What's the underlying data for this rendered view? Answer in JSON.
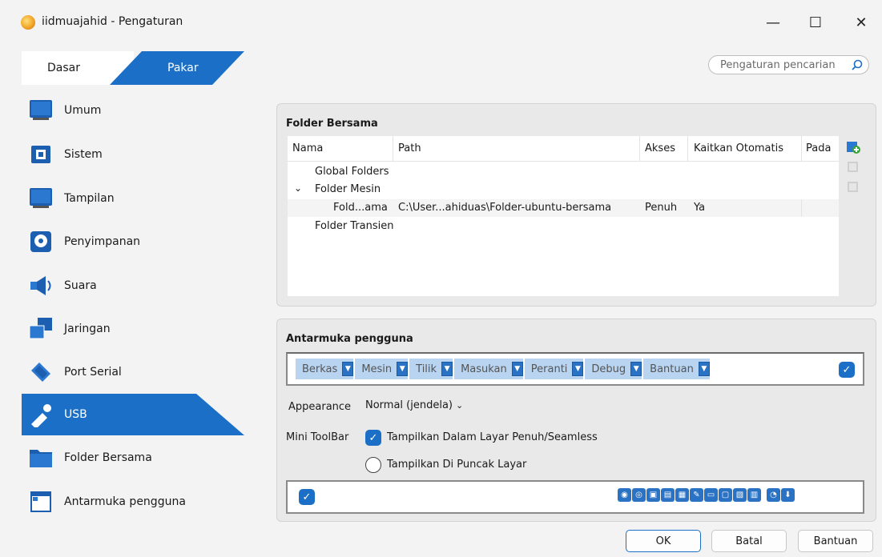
{
  "window": {
    "title": "iidmuajahid - Pengaturan",
    "minimize": "—",
    "maximize": "☐",
    "close": "✕"
  },
  "mode_tabs": {
    "basic": "Dasar",
    "expert": "Pakar"
  },
  "search": {
    "placeholder": "Pengaturan pencarian"
  },
  "sidebar": {
    "items": [
      {
        "label": "Umum",
        "icon": "monitor-icon",
        "selected": false
      },
      {
        "label": "Sistem",
        "icon": "chip-icon",
        "selected": false
      },
      {
        "label": "Tampilan",
        "icon": "display-icon",
        "selected": false
      },
      {
        "label": "Penyimpanan",
        "icon": "storage-icon",
        "selected": false
      },
      {
        "label": "Suara",
        "icon": "speaker-icon",
        "selected": false
      },
      {
        "label": "Jaringan",
        "icon": "network-icon",
        "selected": false
      },
      {
        "label": "Port Serial",
        "icon": "serial-port-icon",
        "selected": false
      },
      {
        "label": "USB",
        "icon": "usb-icon",
        "selected": true
      },
      {
        "label": "Folder Bersama",
        "icon": "folder-icon",
        "selected": false
      },
      {
        "label": "Antarmuka pengguna",
        "icon": "window-icon",
        "selected": false
      }
    ]
  },
  "shared_folders": {
    "title": "Folder Bersama",
    "columns": [
      "Nama",
      "Path",
      "Akses",
      "Kaitkan Otomatis",
      "Pada"
    ],
    "rows": [
      {
        "name": "Global Folders",
        "path": "",
        "access": "",
        "auto": "",
        "at": ""
      },
      {
        "name": "Folder Mesin",
        "path": "",
        "access": "",
        "auto": "",
        "at": "",
        "expanded": true
      },
      {
        "name": "Fold...ama",
        "path": "C:\\User...ahiduas\\Folder-ubuntu-bersama",
        "access": "Penuh",
        "auto": "Ya",
        "at": ""
      },
      {
        "name": "Folder Transien",
        "path": "",
        "access": "",
        "auto": "",
        "at": ""
      }
    ]
  },
  "user_interface": {
    "title": "Antarmuka pengguna",
    "menus": [
      "Berkas",
      "Mesin",
      "Tilik",
      "Masukan",
      "Peranti",
      "Debug",
      "Bantuan"
    ],
    "appearance_label": "Appearance",
    "appearance_value": "Normal (jendela)",
    "mini_toolbar_label": "Mini ToolBar",
    "opt_fullscreen": "Tampilkan Dalam Layar Penuh/Seamless",
    "opt_fullscreen_checked": true,
    "opt_top": "Tampilkan Di Puncak Layar",
    "opt_top_checked": false
  },
  "buttons": {
    "ok": "OK",
    "cancel": "Batal",
    "help": "Bantuan"
  },
  "colors": {
    "accent": "#1c6fc6"
  }
}
